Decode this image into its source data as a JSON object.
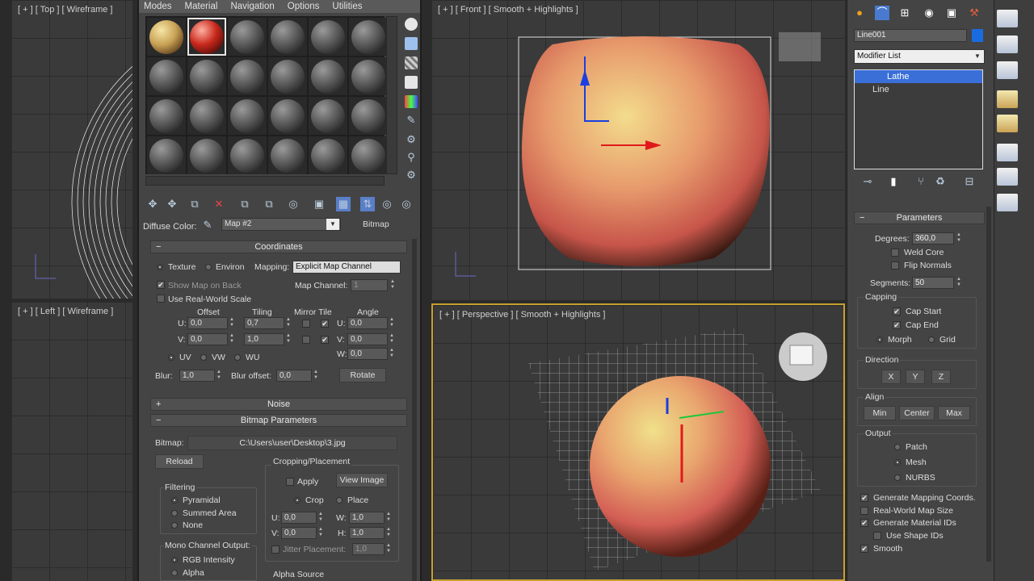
{
  "viewports": {
    "top": {
      "label": "[ + ] [ Top ] [ Wireframe ]"
    },
    "left": {
      "label": "[ + ] [ Left ] [ Wireframe ]"
    },
    "front": {
      "label": "[ + ] [ Front ] [ Smooth + Highlights ]"
    },
    "perspective": {
      "label": "[ + ] [ Perspective ] [ Smooth + Highlights ]"
    }
  },
  "material_editor": {
    "menu": [
      "Modes",
      "Material",
      "Navigation",
      "Options",
      "Utilities"
    ],
    "diffuse_label": "Diffuse Color:",
    "map_name": "Map #2",
    "map_type": "Bitmap",
    "coordinates": {
      "title": "Coordinates",
      "texture": "Texture",
      "environ": "Environ",
      "mapping_label": "Mapping:",
      "mapping_value": "Explicit Map Channel",
      "show_map_on_back": "Show Map on Back",
      "map_channel_label": "Map Channel:",
      "map_channel_value": "1",
      "use_real_world": "Use Real-World Scale",
      "offset": "Offset",
      "tiling": "Tiling",
      "mirror_tile": "Mirror Tile",
      "angle": "Angle",
      "u_label": "U:",
      "v_label": "V:",
      "w_label": "W:",
      "u_offset": "0,0",
      "v_offset": "0,0",
      "u_tiling": "0,7",
      "v_tiling": "1,0",
      "u_angle": "0,0",
      "v_angle": "0,0",
      "w_angle": "0,0",
      "uv": "UV",
      "vw": "VW",
      "wu": "WU",
      "blur_label": "Blur:",
      "blur_value": "1,0",
      "blur_offset_label": "Blur offset:",
      "blur_offset_value": "0,0",
      "rotate": "Rotate"
    },
    "noise": {
      "title": "Noise"
    },
    "bitmap_params": {
      "title": "Bitmap Parameters",
      "bitmap_label": "Bitmap:",
      "bitmap_path": "C:\\Users\\user\\Desktop\\3.jpg",
      "reload": "Reload",
      "cropping": "Cropping/Placement",
      "apply": "Apply",
      "view_image": "View Image",
      "crop": "Crop",
      "place": "Place",
      "u_label": "U:",
      "v_label": "V:",
      "w_label": "W:",
      "h_label": "H:",
      "u_value": "0,0",
      "v_value": "0,0",
      "w_value": "1,0",
      "h_value": "1,0",
      "jitter": "Jitter Placement:",
      "jitter_value": "1,0",
      "filtering": "Filtering",
      "pyramidal": "Pyramidal",
      "summed_area": "Summed Area",
      "none": "None",
      "mono_output": "Mono Channel Output:",
      "rgb_intensity": "RGB Intensity",
      "alpha": "Alpha",
      "alpha_source": "Alpha Source"
    }
  },
  "command_panel": {
    "object_name": "Line001",
    "modifier_list": "Modifier List",
    "stack": [
      "Lathe",
      "Line"
    ],
    "parameters": {
      "title": "Parameters",
      "degrees_label": "Degrees:",
      "degrees_value": "360,0",
      "weld_core": "Weld Core",
      "flip_normals": "Flip Normals",
      "segments_label": "Segments:",
      "segments_value": "50",
      "capping": "Capping",
      "cap_start": "Cap Start",
      "cap_end": "Cap End",
      "morph": "Morph",
      "grid": "Grid",
      "direction": "Direction",
      "x": "X",
      "y": "Y",
      "z": "Z",
      "align": "Align",
      "min": "Min",
      "center": "Center",
      "max": "Max",
      "output": "Output",
      "patch": "Patch",
      "mesh": "Mesh",
      "nurbs": "NURBS",
      "gen_mapping": "Generate Mapping Coords.",
      "real_world": "Real-World Map Size",
      "gen_material_ids": "Generate Material IDs",
      "use_shape_ids": "Use Shape IDs",
      "smooth": "Smooth"
    }
  },
  "colors": {
    "selection": "#3a6fd8",
    "apple_light": "#f0c27a",
    "apple_red": "#d2524a"
  }
}
